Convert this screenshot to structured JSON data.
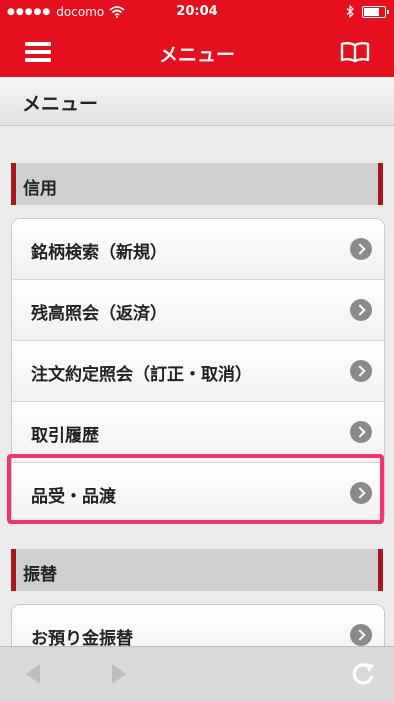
{
  "status_bar": {
    "signal_dots": "●●●●●",
    "carrier": "docomo",
    "time": "20:04",
    "battery_level": 0.85,
    "icons": [
      "wifi-icon",
      "bluetooth-icon",
      "battery-icon"
    ]
  },
  "nav": {
    "title": "メニュー",
    "left_icon": "hamburger-menu-icon",
    "right_icon": "book-icon"
  },
  "page_title": "メニュー",
  "sections": [
    {
      "title": "信用",
      "items": [
        {
          "label": "銘柄検索（新規）"
        },
        {
          "label": "残高照会（返済）"
        },
        {
          "label": "注文約定照会（訂正・取消）"
        },
        {
          "label": "取引履歴"
        },
        {
          "label": "品受・品渡"
        }
      ]
    },
    {
      "title": "振替",
      "items": [
        {
          "label": "お預り金振替"
        }
      ]
    }
  ],
  "toolbar": {
    "icons": [
      "back-arrow-icon",
      "forward-arrow-icon",
      "reload-icon"
    ]
  },
  "colors": {
    "brand_red": "#e60f1e",
    "section_accent": "#a6161f",
    "highlight": "#f2346c"
  }
}
